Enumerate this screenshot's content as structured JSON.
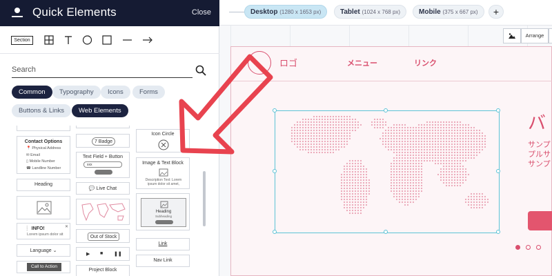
{
  "panel": {
    "title": "Quick Elements",
    "close_label": "Close",
    "section_tool_label": "Section",
    "search_placeholder": "Search",
    "filters": [
      {
        "label": "Common",
        "active": true
      },
      {
        "label": "Typography",
        "active": false
      },
      {
        "label": "Icons",
        "active": false
      },
      {
        "label": "Forms",
        "active": false
      },
      {
        "label": "Buttons & Links",
        "active": false
      },
      {
        "label": "Web Elements",
        "active": true
      }
    ],
    "cards": {
      "contact": {
        "title": "Contact Options",
        "lines": [
          "Physical Address",
          "Email",
          "Mobile Number",
          "Landline Number"
        ]
      },
      "heading": "Heading",
      "info_title": "INFO!",
      "info_text": "Lorem ipsum dolor sit",
      "language": "Language",
      "call_to_action": "Call to Action",
      "badge": "7 Badge",
      "textfield_title": "Text Field + Button",
      "textfield_value": "xxx",
      "live_chat": "Live Chat",
      "out_of_stock": "Out of Stock",
      "project_block": "Project Block",
      "icon_circle": "Icon Circle",
      "image_text_title": "Image & Text Block",
      "image_text_desc": "Description Text: Lorem ipsum dolor sit amet,",
      "image_heading": "Heading",
      "image_subheading": "Subheading",
      "link": "Link",
      "nav_link": "Nav Link"
    }
  },
  "topbar": {
    "devices": [
      {
        "name": "Desktop",
        "dims": "(1280 x 1653 px)",
        "active": true
      },
      {
        "name": "Tablet",
        "dims": "(1024 x 768 px)",
        "active": false
      },
      {
        "name": "Mobile",
        "dims": "(375 x 667 px)",
        "active": false
      }
    ],
    "add_label": "+"
  },
  "canvas": {
    "arrange_label": "Arrange",
    "nav_logo": "ロゴ",
    "nav_menu": "メニュー",
    "nav_link": "リンク",
    "hero_title": "バ",
    "hero_sub_lines": [
      "サンプ",
      "プルサ",
      "サンプ"
    ],
    "slider_dots": [
      true,
      false,
      false
    ]
  },
  "colors": {
    "header_bg": "#151b33",
    "accent_pink": "#d94f6e",
    "selection_blue": "#5cc3d6",
    "active_tab": "#c9e6f4",
    "arrow": "#e8434f"
  }
}
